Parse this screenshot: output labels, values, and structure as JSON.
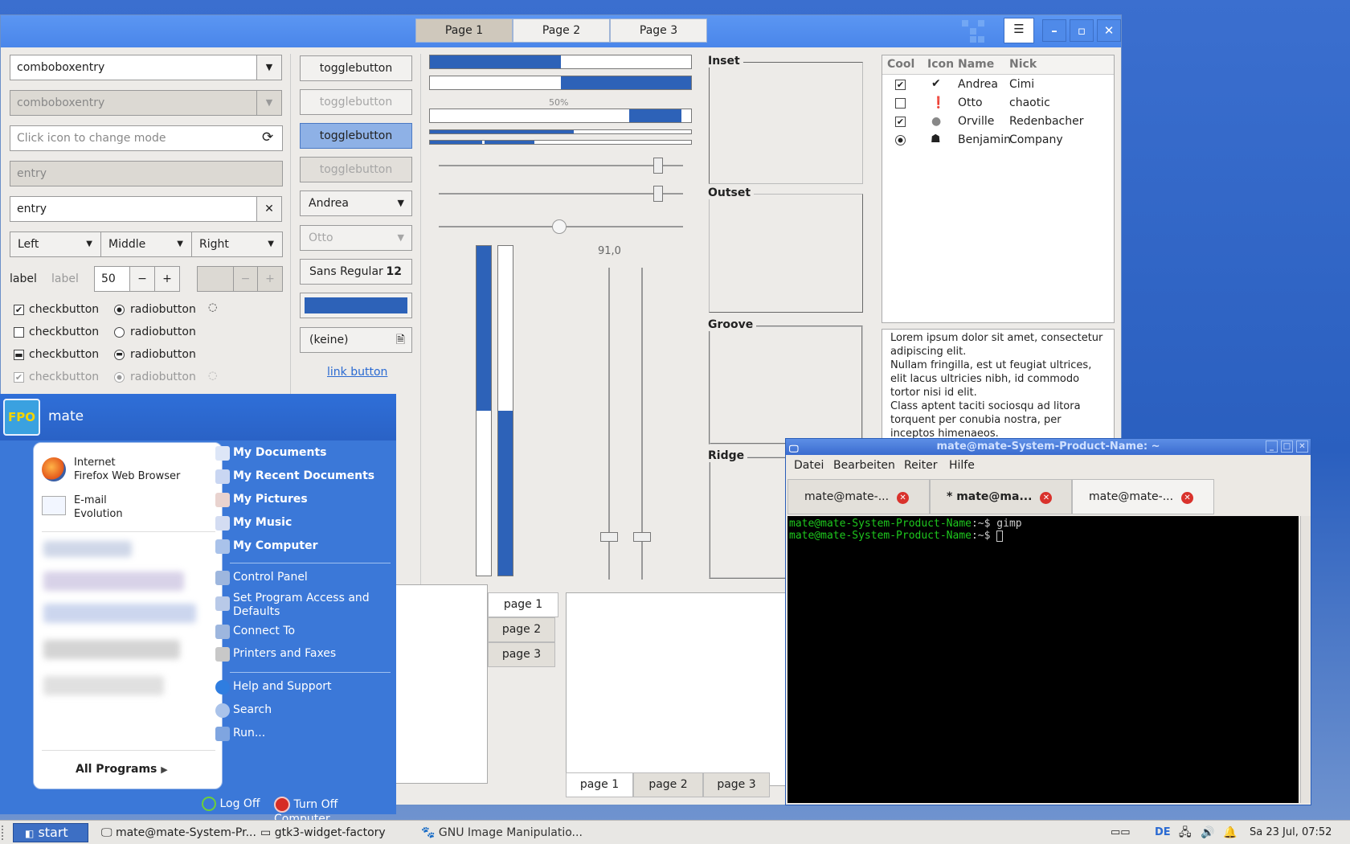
{
  "gtk": {
    "tabs": [
      "Page 1",
      "Page 2",
      "Page 3"
    ],
    "combo1": "comboboxentry",
    "combo2": "comboboxentry",
    "entry_placeholder": "Click icon to change mode",
    "entry_disabled": "entry",
    "entry_clear": "entry",
    "align_buttons": [
      "Left",
      "Middle",
      "Right"
    ],
    "label1": "label",
    "label2": "label",
    "spin_value": "50",
    "minus": "−",
    "plus": "+",
    "check_label": "checkbutton",
    "radio_label": "radiobutton",
    "toggle_label": "togglebutton",
    "combo_andrea": "Andrea",
    "combo_otto": "Otto",
    "font_name": "Sans Regular",
    "font_size": "12",
    "file_none": "(keine)",
    "link_button": "link button",
    "progress_text": "50%",
    "scale_value": "91,0",
    "frames": [
      "Inset",
      "Outset",
      "Groove",
      "Ridge"
    ],
    "tree_headers": [
      "Cool",
      "Icon",
      "Name",
      "Nick"
    ],
    "tree_rows": [
      {
        "name": "Andrea",
        "nick": "Cimi"
      },
      {
        "name": "Otto",
        "nick": "chaotic"
      },
      {
        "name": "Orville",
        "nick": "Redenbacher"
      },
      {
        "name": "Benjamin",
        "nick": "Company"
      }
    ],
    "textview": [
      "Lorem ipsum dolor sit amet, consectetur",
      "adipiscing elit.",
      "Nullam fringilla, est ut feugiat ultrices,",
      "elit lacus ultricies nibh, id commodo",
      "tortor nisi id elit.",
      "Class aptent taciti sociosqu ad litora",
      "torquent per conubia nostra, per",
      "inceptos himenaeos."
    ],
    "side_tabs": [
      "page 1",
      "page 2",
      "page 3"
    ],
    "bottom_tabs": [
      "page 1",
      "page 2",
      "page 3"
    ]
  },
  "terminal": {
    "title": "mate@mate-System-Product-Name: ~",
    "menu": [
      "Datei",
      "Bearbeiten",
      "Reiter",
      "Hilfe"
    ],
    "tabs": [
      "mate@mate-...",
      "* mate@ma...",
      "mate@mate-..."
    ],
    "prompt": "mate@mate-System-Product-Name",
    "sep": ":~$ ",
    "cmd1": "gimp"
  },
  "startmenu": {
    "user": "mate",
    "logo": "FPO",
    "pinned": [
      {
        "title": "Internet",
        "sub": "Firefox Web Browser"
      },
      {
        "title": "E-mail",
        "sub": "Evolution"
      }
    ],
    "all_programs": "All Programs",
    "places": [
      "My Documents",
      "My Recent Documents",
      "My Pictures",
      "My Music",
      "My Computer"
    ],
    "system": [
      "Control Panel",
      "Set Program Access and",
      "Defaults",
      "Connect To",
      "Printers and Faxes"
    ],
    "help": [
      "Help and Support",
      "Search",
      "Run..."
    ],
    "log_off": "Log Off",
    "turn_off": "Turn Off Computer"
  },
  "taskbar": {
    "start": "start",
    "items": [
      "mate@mate-System-Pr...",
      "gtk3-widget-factory",
      "GNU Image Manipulatio..."
    ],
    "lang": "DE",
    "clock": "Sa 23 Jul, 07:52"
  },
  "colors": {
    "accent": "#2d62b8",
    "header": "#4a86ea",
    "terminal_prompt": "#1ec81e"
  }
}
